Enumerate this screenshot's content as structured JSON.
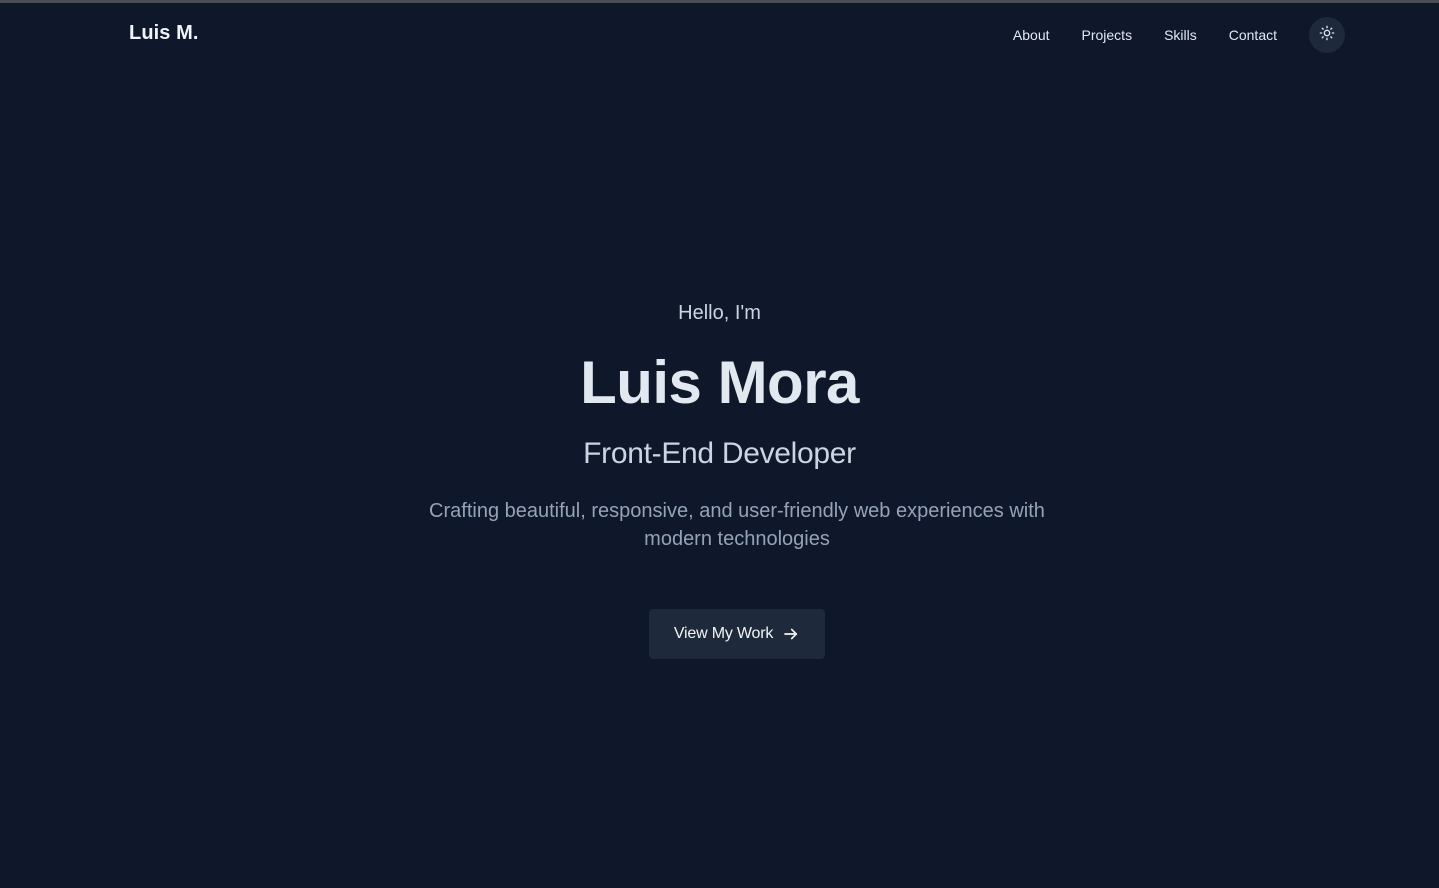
{
  "nav": {
    "logo": "Luis M.",
    "links": [
      "About",
      "Projects",
      "Skills",
      "Contact"
    ],
    "theme_toggle_icon": "sun-icon"
  },
  "hero": {
    "greeting": "Hello, I'm",
    "name": "Luis Mora",
    "role": "Front-End Developer",
    "tagline": "Crafting beautiful, responsive, and user-friendly web experiences with modern technologies",
    "cta_label": "View My Work",
    "cta_icon": "arrow-right-icon"
  },
  "colors": {
    "background": "#0f172a",
    "surface": "#1e293b",
    "text_primary": "#e2e8f0",
    "text_muted": "#94a3b8"
  }
}
